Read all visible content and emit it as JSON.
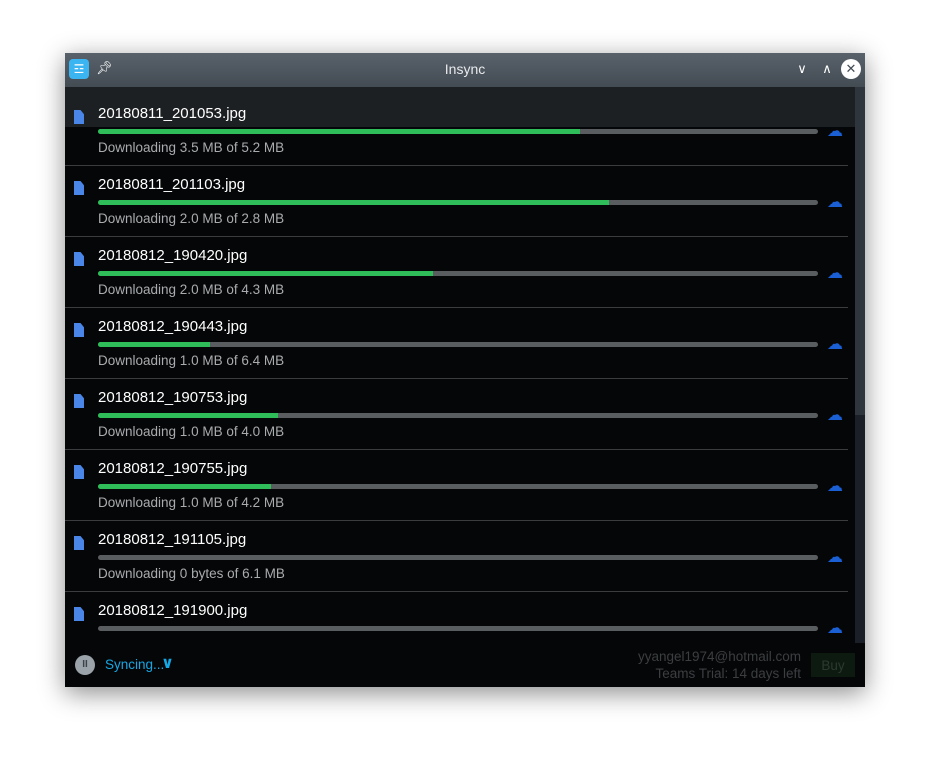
{
  "window": {
    "title": "Insync",
    "icons": {
      "app": "insync-logo-icon",
      "pin": "pin-icon",
      "minimize": "chevron-down-icon",
      "maximize": "chevron-up-icon",
      "close": "close-icon"
    }
  },
  "colors": {
    "progress": "#2ebd59",
    "track": "#5a5d60",
    "cloud": "#1a5fd4",
    "syncing": "#15a8e6"
  },
  "downloads": [
    {
      "name": "20180811_201053.jpg",
      "status": "Downloading 3.5 MB of 5.2 MB",
      "progress": 0.67
    },
    {
      "name": "20180811_201103.jpg",
      "status": "Downloading 2.0 MB of 2.8 MB",
      "progress": 0.71
    },
    {
      "name": "20180812_190420.jpg",
      "status": "Downloading 2.0 MB of 4.3 MB",
      "progress": 0.465
    },
    {
      "name": "20180812_190443.jpg",
      "status": "Downloading 1.0 MB of 6.4 MB",
      "progress": 0.156
    },
    {
      "name": "20180812_190753.jpg",
      "status": "Downloading 1.0 MB of 4.0 MB",
      "progress": 0.25
    },
    {
      "name": "20180812_190755.jpg",
      "status": "Downloading 1.0 MB of 4.2 MB",
      "progress": 0.24
    },
    {
      "name": "20180812_191105.jpg",
      "status": "Downloading 0 bytes of 6.1 MB",
      "progress": 0
    },
    {
      "name": "20180812_191900.jpg",
      "progress": 0
    }
  ],
  "footer": {
    "syncing_label": "Syncing...",
    "email": "yyangel1974@hotmail.com",
    "trial": "Teams Trial: 14 days left",
    "buy_label": "Buy"
  }
}
